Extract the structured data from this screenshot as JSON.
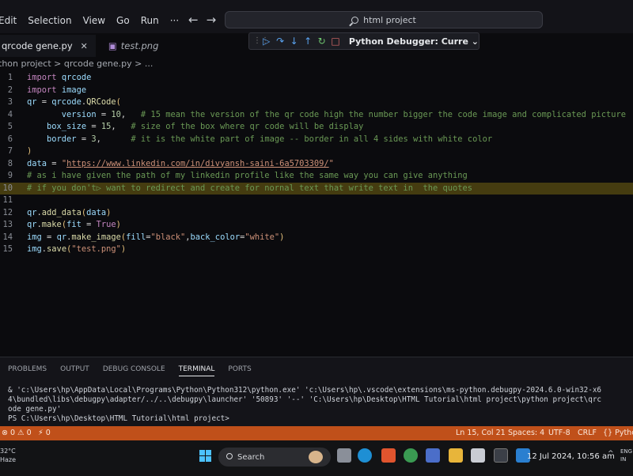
{
  "menu": [
    "Edit",
    "Selection",
    "View",
    "Go",
    "Run",
    "···"
  ],
  "search": {
    "text": "html project"
  },
  "debug_toolbar": {
    "buttons": [
      "continue-icon",
      "step-over-icon",
      "step-into-icon",
      "step-out-icon",
      "restart-icon",
      "stop-icon"
    ],
    "config_label": "Python Debugger: Curre"
  },
  "tabs": [
    {
      "label": "qrcode gene.py",
      "active": true
    },
    {
      "label": "test.png",
      "active": false
    }
  ],
  "breadcrumb": "thon project  >  qrcode gene.py  >  ...",
  "editor": {
    "highlighted_line": 10,
    "lines": [
      {
        "n": "1",
        "tokens": [
          [
            "kw",
            "import"
          ],
          [
            "pl",
            " "
          ],
          [
            "var",
            "qrcode"
          ]
        ]
      },
      {
        "n": "2",
        "tokens": [
          [
            "kw",
            "import"
          ],
          [
            "pl",
            " "
          ],
          [
            "var",
            "image"
          ]
        ]
      },
      {
        "n": "3",
        "tokens": [
          [
            "var",
            "qr"
          ],
          [
            "op",
            " = "
          ],
          [
            "var",
            "qrcode"
          ],
          [
            "pl",
            "."
          ],
          [
            "fn",
            "QRCode"
          ],
          [
            "brk",
            "("
          ]
        ]
      },
      {
        "n": "4",
        "tokens": [
          [
            "pl",
            "       "
          ],
          [
            "var",
            "version"
          ],
          [
            "op",
            " = "
          ],
          [
            "num",
            "10"
          ],
          [
            "pl",
            ",   "
          ],
          [
            "cm",
            "# 15 mean the version of the qr code high the number bigger the code image and complicated picture"
          ]
        ]
      },
      {
        "n": "5",
        "tokens": [
          [
            "pl",
            "    "
          ],
          [
            "var",
            "box_size"
          ],
          [
            "op",
            " = "
          ],
          [
            "num",
            "15"
          ],
          [
            "pl",
            ",   "
          ],
          [
            "cm",
            "# size of the box where qr code will be display"
          ]
        ]
      },
      {
        "n": "6",
        "tokens": [
          [
            "pl",
            "    "
          ],
          [
            "var",
            "border"
          ],
          [
            "op",
            " = "
          ],
          [
            "num",
            "3"
          ],
          [
            "pl",
            ",      "
          ],
          [
            "cm",
            "# it is the white part of image -- border in all 4 sides with white color"
          ]
        ]
      },
      {
        "n": "7",
        "tokens": [
          [
            "brk",
            ")"
          ]
        ]
      },
      {
        "n": "8",
        "tokens": [
          [
            "var",
            "data"
          ],
          [
            "op",
            " = "
          ],
          [
            "str",
            "\""
          ],
          [
            "url",
            "https://www.linkedin.com/in/divyansh-saini-6a5703309/"
          ],
          [
            "str",
            "\""
          ]
        ]
      },
      {
        "n": "9",
        "tokens": [
          [
            "cm",
            "# as i have given the path of my linkedin profile like the same way you can give anything"
          ]
        ]
      },
      {
        "n": "10",
        "tokens": [
          [
            "cm",
            "# if you don't▷ want to redirect and create for nornal text that write text in  the quotes"
          ]
        ]
      },
      {
        "n": "11",
        "tokens": []
      },
      {
        "n": "12",
        "tokens": [
          [
            "var",
            "qr"
          ],
          [
            "pl",
            "."
          ],
          [
            "fn",
            "add_data"
          ],
          [
            "brk",
            "("
          ],
          [
            "var",
            "data"
          ],
          [
            "brk",
            ")"
          ]
        ]
      },
      {
        "n": "13",
        "tokens": [
          [
            "var",
            "qr"
          ],
          [
            "pl",
            "."
          ],
          [
            "fn",
            "make"
          ],
          [
            "brk",
            "("
          ],
          [
            "var",
            "fit"
          ],
          [
            "op",
            " = "
          ],
          [
            "kw",
            "True"
          ],
          [
            "brk",
            ")"
          ]
        ]
      },
      {
        "n": "14",
        "tokens": [
          [
            "var",
            "img"
          ],
          [
            "op",
            " = "
          ],
          [
            "var",
            "qr"
          ],
          [
            "pl",
            "."
          ],
          [
            "fn",
            "make_image"
          ],
          [
            "brk",
            "("
          ],
          [
            "var",
            "fill"
          ],
          [
            "op",
            "="
          ],
          [
            "str",
            "\"black\""
          ],
          [
            "pl",
            ","
          ],
          [
            "var",
            "back_color"
          ],
          [
            "op",
            "="
          ],
          [
            "str",
            "\"white\""
          ],
          [
            "brk",
            ")"
          ]
        ]
      },
      {
        "n": "15",
        "tokens": [
          [
            "var",
            "img"
          ],
          [
            "pl",
            "."
          ],
          [
            "fn",
            "save"
          ],
          [
            "brk",
            "("
          ],
          [
            "str",
            "\"test.png\""
          ],
          [
            "brk",
            ")"
          ]
        ]
      }
    ]
  },
  "panel": {
    "tabs": [
      "PROBLEMS",
      "OUTPUT",
      "DEBUG CONSOLE",
      "TERMINAL",
      "PORTS"
    ],
    "active_tab": "TERMINAL",
    "terminal_lines": [
      "& 'c:\\Users\\hp\\AppData\\Local\\Programs\\Python\\Python312\\python.exe' 'c:\\Users\\hp\\.vscode\\extensions\\ms-python.debugpy-2024.6.0-win32-x6",
      "4\\bundled\\libs\\debugpy\\adapter/../..\\debugpy\\launcher' '50893' '--' 'C:\\Users\\hp\\Desktop\\HTML Tutorial\\html project\\python project\\qrc",
      "ode gene.py'",
      "PS C:\\Users\\hp\\Desktop\\HTML Tutorial\\html project>"
    ]
  },
  "status_bar": {
    "errors": "⊗ 0 ⚠ 0",
    "ports": "⚡ 0",
    "position": "Ln 15, Col 21",
    "spaces": "Spaces: 4",
    "encoding": "UTF-8",
    "eol": "CRLF",
    "language": "{} Pytho",
    "color": "#c0501a"
  },
  "taskbar": {
    "weather_temp": "32°C",
    "weather_text": "Haze",
    "search_label": "Search",
    "clock": "12 Jul 2024, 10:56 am",
    "lang_top": "ENG",
    "lang_bottom": "IN"
  }
}
